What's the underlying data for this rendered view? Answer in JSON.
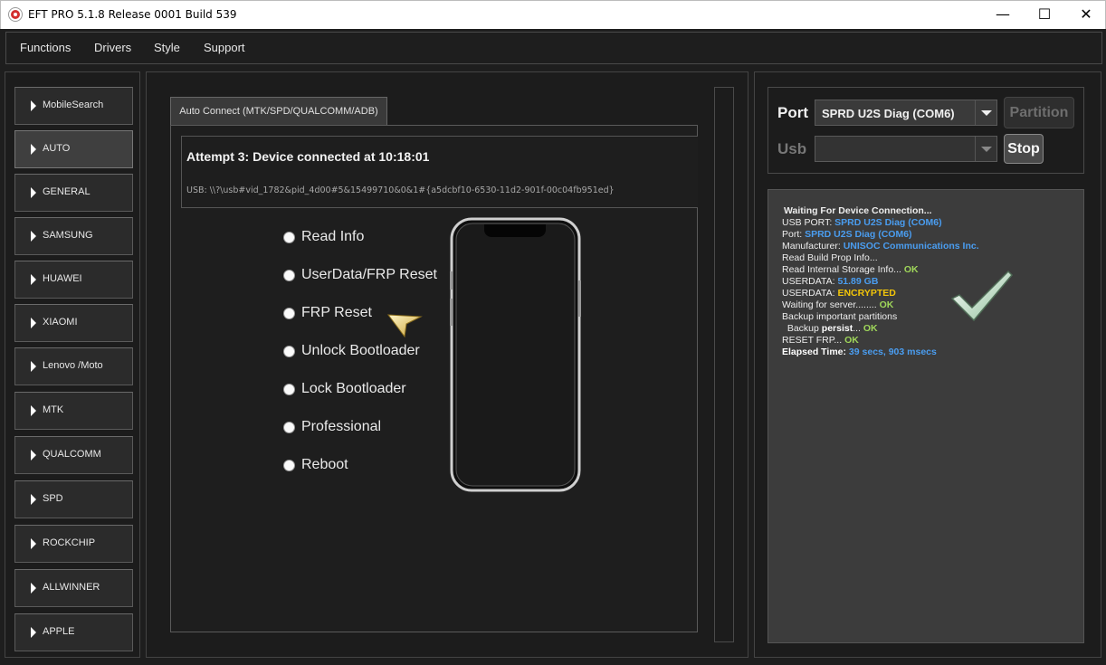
{
  "window": {
    "title": "EFT PRO 5.1.8 Release 0001 Build 539",
    "controls": {
      "minimize": "—",
      "maximize": "☐",
      "close": "✕"
    }
  },
  "menu": [
    {
      "label": "Functions"
    },
    {
      "label": "Drivers"
    },
    {
      "label": "Style"
    },
    {
      "label": "Support"
    }
  ],
  "sidebar": {
    "items": [
      {
        "label": "MobileSearch"
      },
      {
        "label": "AUTO",
        "active": true
      },
      {
        "label": "GENERAL"
      },
      {
        "label": "SAMSUNG"
      },
      {
        "label": "HUAWEI"
      },
      {
        "label": "XIAOMI"
      },
      {
        "label": "Lenovo /Moto"
      },
      {
        "label": "MTK"
      },
      {
        "label": "QUALCOMM"
      },
      {
        "label": "SPD"
      },
      {
        "label": "ROCKCHIP"
      },
      {
        "label": "ALLWINNER"
      },
      {
        "label": "APPLE"
      }
    ]
  },
  "center": {
    "tab_label": "Auto Connect (MTK/SPD/QUALCOMM/ADB)",
    "status_title": "Attempt 3: Device connected at 10:18:01",
    "status_usb": "USB: \\\\?\\usb#vid_1782&pid_4d00#5&15499710&0&1#{a5dcbf10-6530-11d2-901f-00c04fb951ed}",
    "options": [
      {
        "label": "Read Info"
      },
      {
        "label": "UserData/FRP Reset"
      },
      {
        "label": "FRP Reset"
      },
      {
        "label": "Unlock Bootloader"
      },
      {
        "label": "Lock Bootloader"
      },
      {
        "label": "Professional"
      },
      {
        "label": "Reboot"
      }
    ]
  },
  "right": {
    "port_label": "Port",
    "port_value": "SPRD U2S Diag (COM6)",
    "usb_label": "Usb",
    "usb_value": "",
    "partition_label": "Partition",
    "stop_label": "Stop",
    "log": {
      "l1": "Waiting For Device Connection...",
      "l2a": "USB PORT: ",
      "l2b": "SPRD U2S Diag (COM6)",
      "l3a": "Port: ",
      "l3b": "SPRD U2S Diag (COM6)",
      "l4a": "Manufacturer: ",
      "l4b": "UNISOC Communications Inc.",
      "l5": "Read Build Prop Info...",
      "l6a": "Read Internal Storage Info... ",
      "l6b": "OK",
      "l7a": "USERDATA: ",
      "l7b": "51.89 GB",
      "l8a": "USERDATA: ",
      "l8b": "ENCRYPTED",
      "l9a": "Waiting for server........ ",
      "l9b": "OK",
      "l10": "Backup important partitions",
      "l11a": "  Backup ",
      "l11b": "persist",
      "l11c": "... ",
      "l11d": "OK",
      "l12a": "RESET FRP... ",
      "l12b": "OK",
      "l13a": "Elapsed Time: ",
      "l13b": "39 secs, 903 msecs"
    },
    "colors": {
      "blue": "#4a9df0",
      "green": "#9fd65a",
      "yellow": "#f2c50a"
    }
  }
}
